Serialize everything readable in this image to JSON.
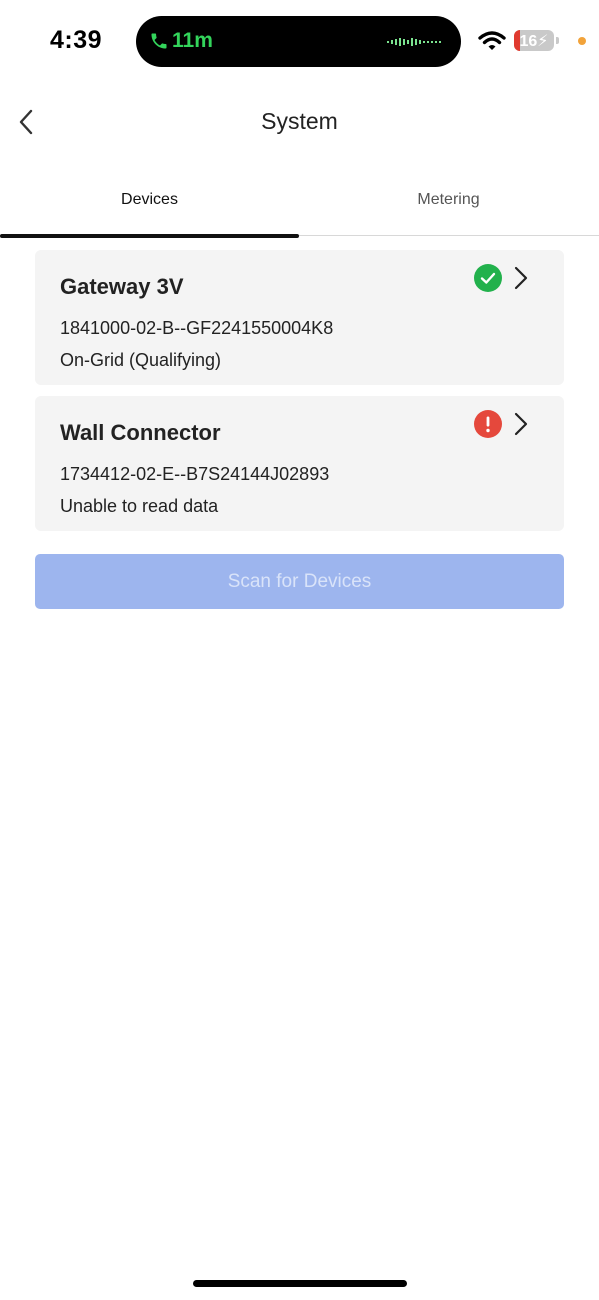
{
  "status_bar": {
    "time": "4:39",
    "call_timer": "11m",
    "battery_level": "16",
    "battery_percent": 16,
    "icons": [
      "phone-icon",
      "audio-wave-icon",
      "wifi-icon",
      "battery-icon"
    ]
  },
  "header": {
    "title": "System"
  },
  "tabs": [
    {
      "label": "Devices",
      "active": true
    },
    {
      "label": "Metering",
      "active": false
    }
  ],
  "devices": [
    {
      "name": "Gateway 3V",
      "serial": "1841000-02-B--GF2241550004K8",
      "status": "On-Grid (Qualifying)",
      "status_icon": "check-circle-icon",
      "status_color": "#22b14c"
    },
    {
      "name": "Wall Connector",
      "serial": "1734412-02-E--B7S24144J02893",
      "status": "Unable to read data",
      "status_icon": "error-circle-icon",
      "status_color": "#e5483c"
    }
  ],
  "actions": {
    "scan_label": "Scan for Devices"
  },
  "colors": {
    "accent_disabled": "#9db5ee",
    "success": "#22b14c",
    "error": "#e5483c",
    "call_green": "#33d45b"
  }
}
